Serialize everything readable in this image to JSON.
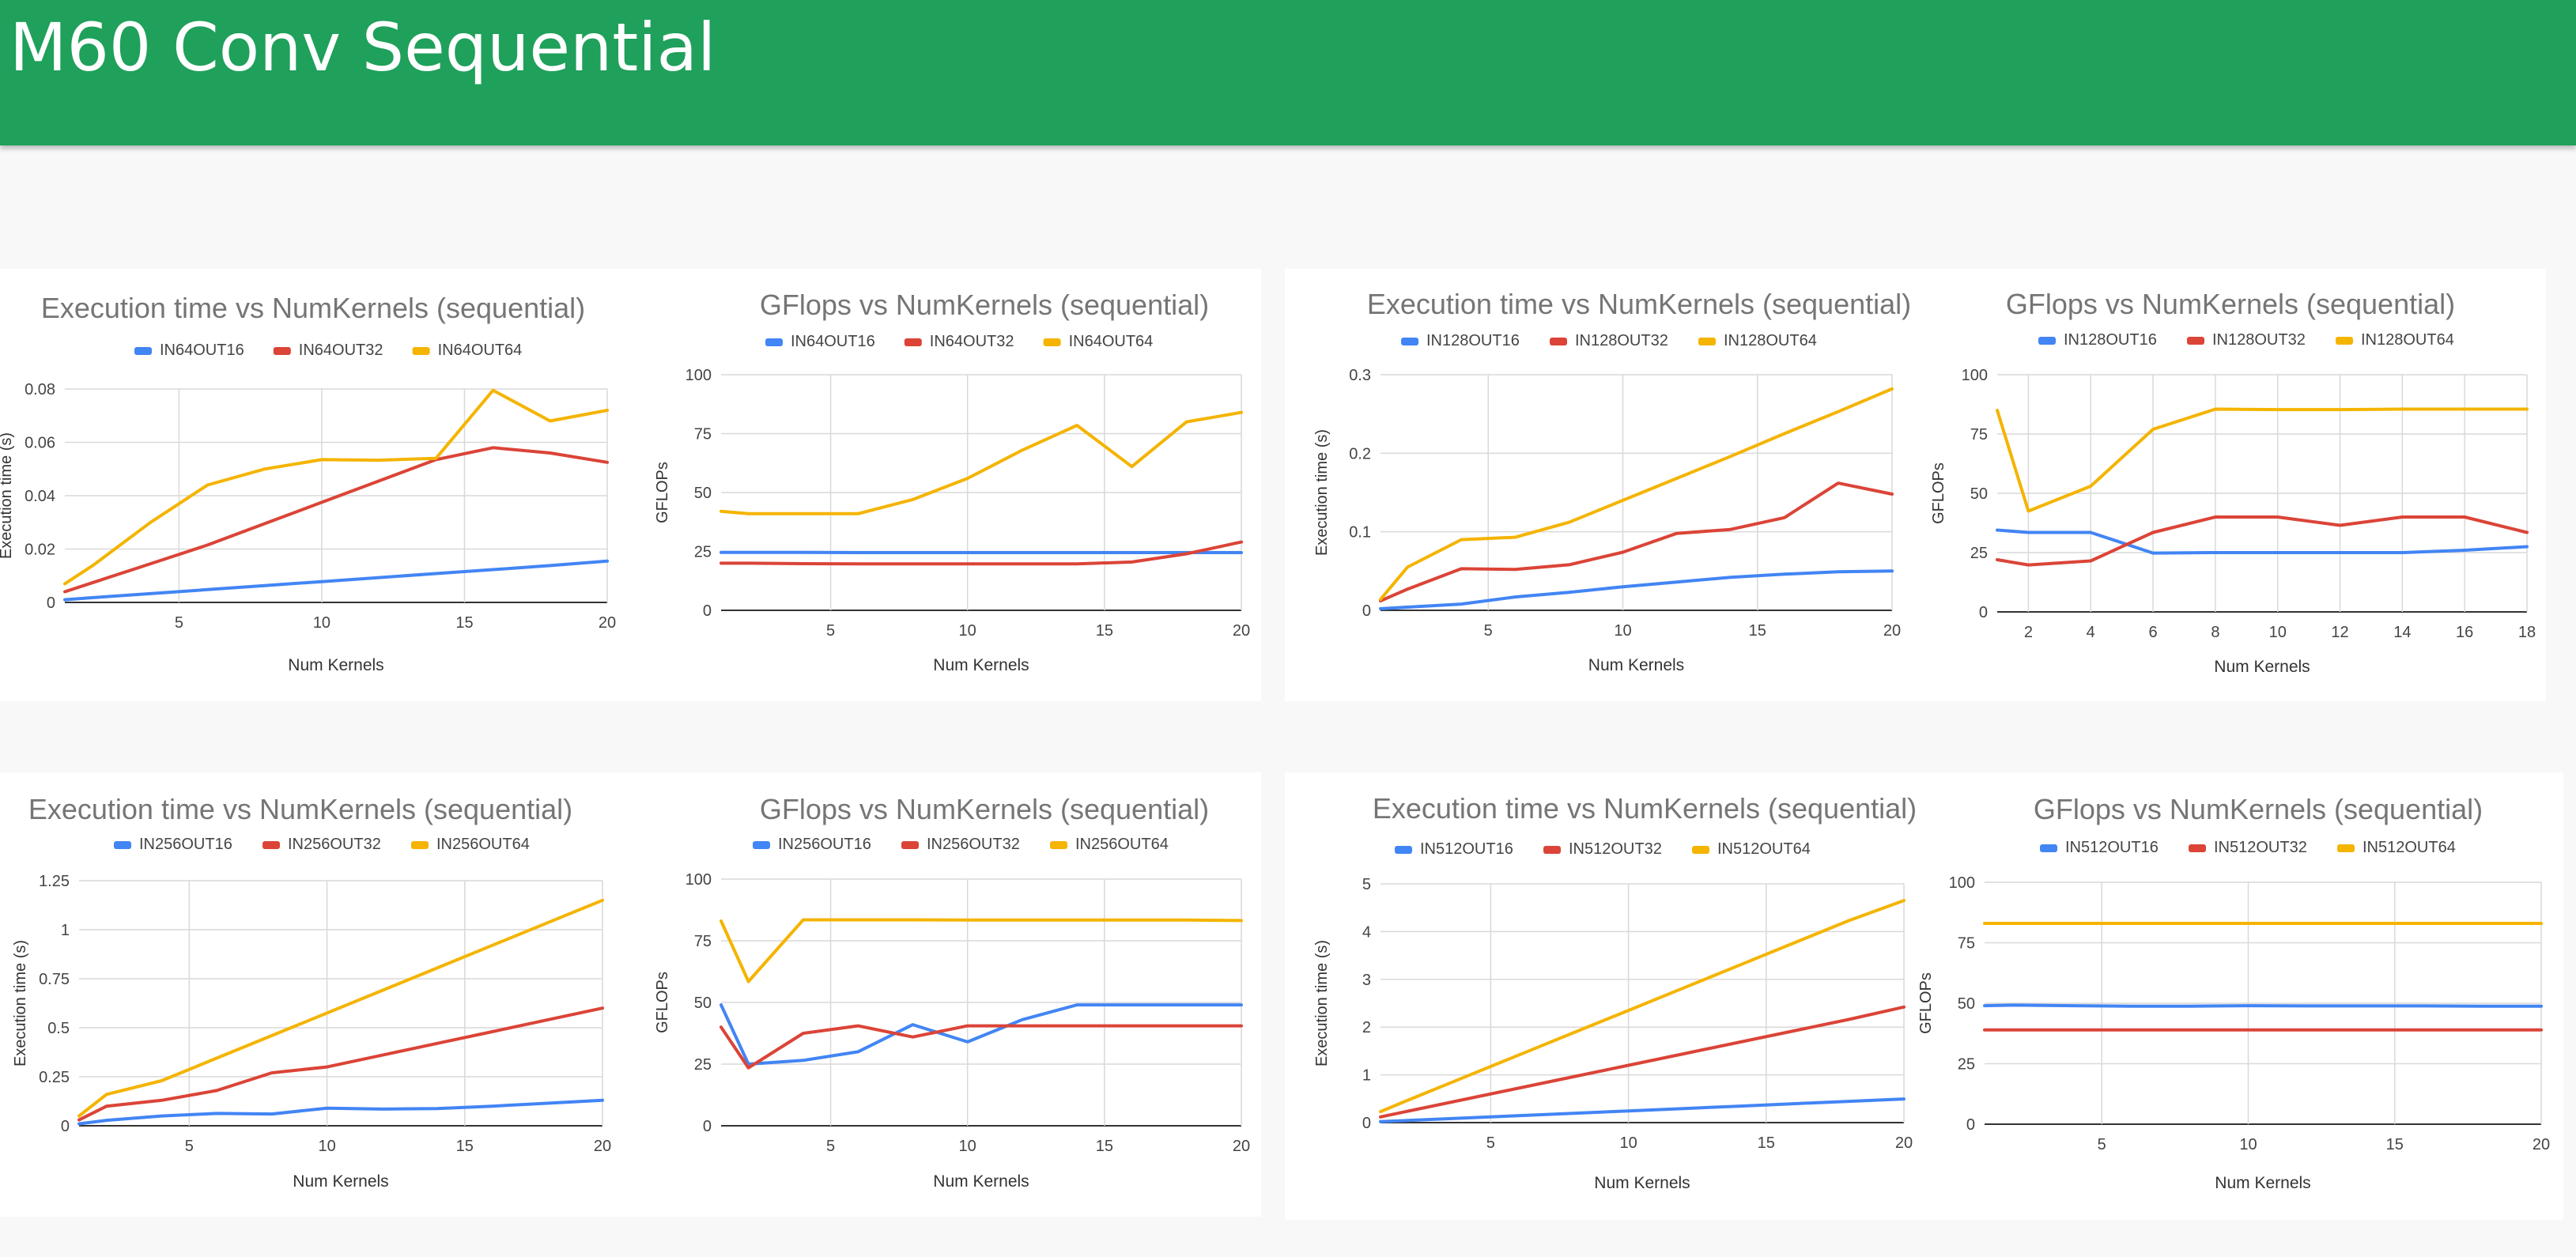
{
  "page": {
    "title": "M60 Conv Sequential"
  },
  "colors": {
    "header": "#1fa05b",
    "s0": "#4285f4",
    "s1": "#db4437",
    "s2": "#f4b400",
    "grid": "#d9d9d9",
    "text": "#444444",
    "title": "#757575"
  },
  "chart_data": [
    {
      "type": "line",
      "title": "Execution time vs NumKernels (sequential)",
      "xlabel": "Num Kernels",
      "ylabel": "Execution time (s)",
      "xlim": [
        1,
        20
      ],
      "ylim": [
        0,
        0.08
      ],
      "xticks": [
        5,
        10,
        15,
        20
      ],
      "yticks": [
        0,
        0.02,
        0.04,
        0.06,
        0.08
      ],
      "ytick_labels": [
        "0",
        "0.02",
        "0.04",
        "0.06",
        "0.08"
      ],
      "legend": "top",
      "series": [
        {
          "name": "IN64OUT16",
          "x": [
            1,
            2,
            4,
            6,
            8,
            10,
            12,
            14,
            16,
            18,
            20
          ],
          "y": [
            0.001,
            0.0018,
            0.0033,
            0.0048,
            0.0063,
            0.0078,
            0.0093,
            0.0108,
            0.0123,
            0.0138,
            0.0155
          ]
        },
        {
          "name": "IN64OUT32",
          "x": [
            1,
            2,
            4,
            6,
            8,
            10,
            12,
            14,
            16,
            18,
            20
          ],
          "y": [
            0.004,
            0.0075,
            0.0145,
            0.0215,
            0.0295,
            0.0375,
            0.0455,
            0.0535,
            0.058,
            0.056,
            0.0525
          ]
        },
        {
          "name": "IN64OUT64",
          "x": [
            1,
            2,
            4,
            6,
            8,
            10,
            12,
            14,
            16,
            18,
            20
          ],
          "y": [
            0.007,
            0.014,
            0.03,
            0.044,
            0.05,
            0.0535,
            0.0533,
            0.054,
            0.0795,
            0.068,
            0.072
          ]
        }
      ]
    },
    {
      "type": "line",
      "title": "GFlops vs NumKernels (sequential)",
      "xlabel": "Num Kernels",
      "ylabel": "GFLOPs",
      "xlim": [
        1,
        20
      ],
      "ylim": [
        0,
        100
      ],
      "xticks": [
        5,
        10,
        15,
        20
      ],
      "yticks": [
        0,
        25,
        50,
        75,
        100
      ],
      "ytick_labels": [
        "0",
        "25",
        "50",
        "75",
        "100"
      ],
      "legend": "top",
      "series": [
        {
          "name": "IN64OUT16",
          "x": [
            1,
            2,
            4,
            6,
            8,
            10,
            12,
            14,
            16,
            18,
            20
          ],
          "y": [
            24.6,
            24.6,
            24.6,
            24.5,
            24.5,
            24.5,
            24.5,
            24.5,
            24.5,
            24.5,
            24.5
          ]
        },
        {
          "name": "IN64OUT32",
          "x": [
            1,
            2,
            4,
            6,
            8,
            10,
            12,
            14,
            16,
            18,
            20
          ],
          "y": [
            20,
            20,
            19.8,
            19.7,
            19.7,
            19.7,
            19.7,
            19.7,
            20.5,
            24,
            29
          ]
        },
        {
          "name": "IN64OUT64",
          "x": [
            1,
            2,
            4,
            6,
            8,
            10,
            12,
            14,
            16,
            18,
            20
          ],
          "y": [
            42,
            41,
            41,
            41,
            47,
            56,
            68,
            78.5,
            61,
            80,
            84
          ]
        }
      ]
    },
    {
      "type": "line",
      "title": "Execution time vs NumKernels (sequential)",
      "xlabel": "Num Kernels",
      "ylabel": "Execution time (s)",
      "xlim": [
        1,
        20
      ],
      "ylim": [
        0,
        0.3
      ],
      "xticks": [
        5,
        10,
        15,
        20
      ],
      "yticks": [
        0,
        0.1,
        0.2,
        0.3
      ],
      "ytick_labels": [
        "0",
        "0.1",
        "0.2",
        "0.3"
      ],
      "legend": "top",
      "series": [
        {
          "name": "IN128OUT16",
          "x": [
            1,
            2,
            4,
            6,
            8,
            10,
            12,
            14,
            16,
            18,
            20
          ],
          "y": [
            0.002,
            0.004,
            0.008,
            0.017,
            0.023,
            0.03,
            0.036,
            0.042,
            0.046,
            0.049,
            0.05
          ]
        },
        {
          "name": "IN128OUT32",
          "x": [
            1,
            2,
            4,
            6,
            8,
            10,
            12,
            14,
            16,
            18,
            20
          ],
          "y": [
            0.012,
            0.027,
            0.053,
            0.052,
            0.058,
            0.074,
            0.098,
            0.103,
            0.118,
            0.162,
            0.148
          ]
        },
        {
          "name": "IN128OUT64",
          "x": [
            1,
            2,
            4,
            6,
            8,
            10,
            12,
            14,
            16,
            18,
            20
          ],
          "y": [
            0.014,
            0.055,
            0.09,
            0.093,
            0.112,
            0.14,
            0.168,
            0.196,
            0.225,
            0.253,
            0.282
          ]
        }
      ]
    },
    {
      "type": "line",
      "title": "GFlops vs NumKernels (sequential)",
      "xlabel": "Num Kernels",
      "ylabel": "GFLOPs",
      "xlim": [
        1,
        18
      ],
      "ylim": [
        0,
        100
      ],
      "xticks": [
        2,
        4,
        6,
        8,
        10,
        12,
        14,
        16,
        18
      ],
      "yticks": [
        0,
        25,
        50,
        75,
        100
      ],
      "ytick_labels": [
        "0",
        "25",
        "50",
        "75",
        "100"
      ],
      "legend": "top",
      "series": [
        {
          "name": "IN128OUT16",
          "x": [
            1,
            2,
            4,
            6,
            8,
            10,
            12,
            14,
            16,
            18
          ],
          "y": [
            34.5,
            33.5,
            33.5,
            24.8,
            25,
            25,
            25,
            25,
            26,
            27.5
          ]
        },
        {
          "name": "IN128OUT32",
          "x": [
            1,
            2,
            4,
            6,
            8,
            10,
            12,
            14,
            16,
            18
          ],
          "y": [
            22,
            19.8,
            21.5,
            33.5,
            40,
            40,
            36.5,
            40,
            40,
            33.5
          ]
        },
        {
          "name": "IN128OUT64",
          "x": [
            1,
            2,
            4,
            6,
            8,
            10,
            12,
            14,
            16,
            18
          ],
          "y": [
            85,
            42.5,
            53,
            77,
            85.5,
            85.3,
            85.3,
            85.5,
            85.5,
            85.5
          ]
        }
      ]
    },
    {
      "type": "line",
      "title": "Execution time vs NumKernels (sequential)",
      "xlabel": "Num Kernels",
      "ylabel": "Execution time (s)",
      "xlim": [
        1,
        20
      ],
      "ylim": [
        0,
        1.25
      ],
      "xticks": [
        5,
        10,
        15,
        20
      ],
      "yticks": [
        0,
        0.25,
        0.5,
        0.75,
        1,
        1.25
      ],
      "ytick_labels": [
        "0",
        "0.25",
        "0.5",
        "0.75",
        "1",
        "1.25"
      ],
      "legend": "top",
      "series": [
        {
          "name": "IN256OUT16",
          "x": [
            1,
            2,
            4,
            6,
            8,
            10,
            12,
            14,
            16,
            18,
            20
          ],
          "y": [
            0.01,
            0.028,
            0.05,
            0.063,
            0.06,
            0.09,
            0.085,
            0.088,
            0.1,
            0.115,
            0.13
          ]
        },
        {
          "name": "IN256OUT32",
          "x": [
            1,
            2,
            4,
            6,
            8,
            10,
            12,
            14,
            16,
            18,
            20
          ],
          "y": [
            0.03,
            0.1,
            0.13,
            0.18,
            0.27,
            0.3,
            0.36,
            0.42,
            0.48,
            0.54,
            0.6
          ]
        },
        {
          "name": "IN256OUT64",
          "x": [
            1,
            2,
            4,
            6,
            8,
            10,
            12,
            14,
            16,
            18,
            20
          ],
          "y": [
            0.05,
            0.16,
            0.23,
            0.345,
            0.46,
            0.575,
            0.69,
            0.805,
            0.92,
            1.035,
            1.15
          ]
        }
      ]
    },
    {
      "type": "line",
      "title": "GFlops vs NumKernels (sequential)",
      "xlabel": "Num Kernels",
      "ylabel": "GFLOPs",
      "xlim": [
        1,
        20
      ],
      "ylim": [
        0,
        100
      ],
      "xticks": [
        5,
        10,
        15,
        20
      ],
      "yticks": [
        0,
        25,
        50,
        75,
        100
      ],
      "ytick_labels": [
        "0",
        "25",
        "50",
        "75",
        "100"
      ],
      "legend": "top",
      "series": [
        {
          "name": "IN256OUT16",
          "x": [
            1,
            2,
            4,
            6,
            8,
            10,
            12,
            14,
            16,
            18,
            20
          ],
          "y": [
            49,
            25,
            26.5,
            30,
            41,
            34,
            43,
            49,
            49,
            49,
            49
          ]
        },
        {
          "name": "IN256OUT32",
          "x": [
            1,
            2,
            4,
            6,
            8,
            10,
            12,
            14,
            16,
            18,
            20
          ],
          "y": [
            40,
            23.5,
            37.5,
            40.5,
            36,
            40.5,
            40.5,
            40.5,
            40.5,
            40.5,
            40.5
          ]
        },
        {
          "name": "IN256OUT64",
          "x": [
            1,
            2,
            4,
            6,
            8,
            10,
            12,
            14,
            16,
            18,
            20
          ],
          "y": [
            83,
            58.5,
            83.5,
            83.5,
            83.5,
            83.4,
            83.4,
            83.4,
            83.4,
            83.4,
            83.2
          ]
        }
      ]
    },
    {
      "type": "line",
      "title": "Execution time vs NumKernels (sequential)",
      "xlabel": "Num Kernels",
      "ylabel": "Execution time (s)",
      "xlim": [
        1,
        20
      ],
      "ylim": [
        0,
        5
      ],
      "xticks": [
        5,
        10,
        15,
        20
      ],
      "yticks": [
        0,
        1,
        2,
        3,
        4,
        5
      ],
      "ytick_labels": [
        "0",
        "1",
        "2",
        "3",
        "4",
        "5"
      ],
      "legend": "top",
      "series": [
        {
          "name": "IN512OUT16",
          "x": [
            1,
            2,
            4,
            6,
            8,
            10,
            12,
            14,
            16,
            18,
            20
          ],
          "y": [
            0.02,
            0.045,
            0.095,
            0.145,
            0.195,
            0.245,
            0.295,
            0.345,
            0.395,
            0.445,
            0.495
          ]
        },
        {
          "name": "IN512OUT32",
          "x": [
            1,
            2,
            4,
            6,
            8,
            10,
            12,
            14,
            16,
            18,
            20
          ],
          "y": [
            0.12,
            0.24,
            0.48,
            0.72,
            0.96,
            1.2,
            1.44,
            1.68,
            1.92,
            2.16,
            2.42
          ]
        },
        {
          "name": "IN512OUT64",
          "x": [
            1,
            2,
            4,
            6,
            8,
            10,
            12,
            14,
            16,
            18,
            20
          ],
          "y": [
            0.23,
            0.47,
            0.94,
            1.41,
            1.88,
            2.35,
            2.82,
            3.29,
            3.76,
            4.23,
            4.65
          ]
        }
      ]
    },
    {
      "type": "line",
      "title": "GFlops vs NumKernels (sequential)",
      "xlabel": "Num Kernels",
      "ylabel": "GFLOPs",
      "xlim": [
        1,
        20
      ],
      "ylim": [
        0,
        100
      ],
      "xticks": [
        5,
        10,
        15,
        20
      ],
      "yticks": [
        0,
        25,
        50,
        75,
        100
      ],
      "ytick_labels": [
        "0",
        "25",
        "50",
        "75",
        "100"
      ],
      "legend": "top",
      "series": [
        {
          "name": "IN512OUT16",
          "x": [
            1,
            2,
            4,
            6,
            8,
            10,
            12,
            14,
            16,
            18,
            20
          ],
          "y": [
            49,
            49.2,
            49,
            48.8,
            48.8,
            49,
            48.9,
            48.9,
            48.9,
            48.8,
            48.8
          ]
        },
        {
          "name": "IN512OUT32",
          "x": [
            1,
            2,
            4,
            6,
            8,
            10,
            12,
            14,
            16,
            18,
            20
          ],
          "y": [
            39,
            39,
            39,
            39,
            39,
            39,
            39,
            39,
            39,
            39,
            39
          ]
        },
        {
          "name": "IN512OUT64",
          "x": [
            1,
            2,
            4,
            6,
            8,
            10,
            12,
            14,
            16,
            18,
            20
          ],
          "y": [
            83,
            83,
            83,
            83,
            83,
            83,
            83,
            83,
            83,
            83,
            83
          ]
        }
      ]
    }
  ]
}
